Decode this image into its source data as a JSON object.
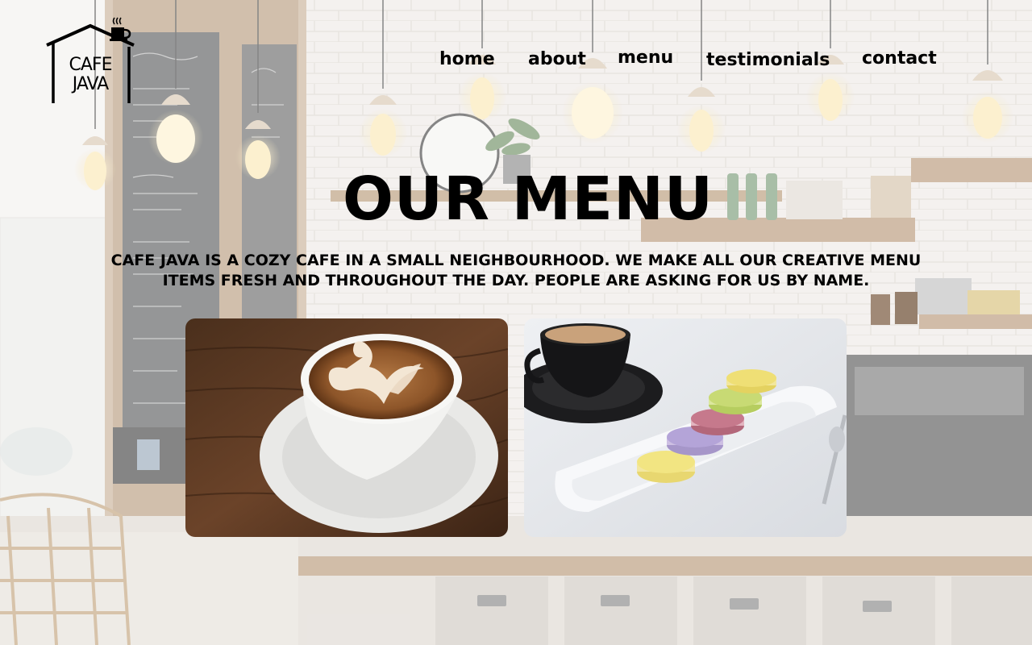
{
  "brand": {
    "line1": "CAFE",
    "line2": "JAVA"
  },
  "nav": {
    "items": [
      "home",
      "about",
      "menu",
      "testimonials",
      "contact"
    ]
  },
  "hero": {
    "title": "OUR MENU",
    "description": "CAFE JAVA IS A COZY CAFE IN A SMALL NEIGHBOURHOOD. WE MAKE ALL OUR CREATIVE MENU ITEMS FRESH AND THROUGHOUT THE DAY. PEOPLE ARE ASKING FOR US BY NAME."
  },
  "images": [
    {
      "name": "latte-art-coffee-image"
    },
    {
      "name": "coffee-and-macarons-image"
    }
  ]
}
